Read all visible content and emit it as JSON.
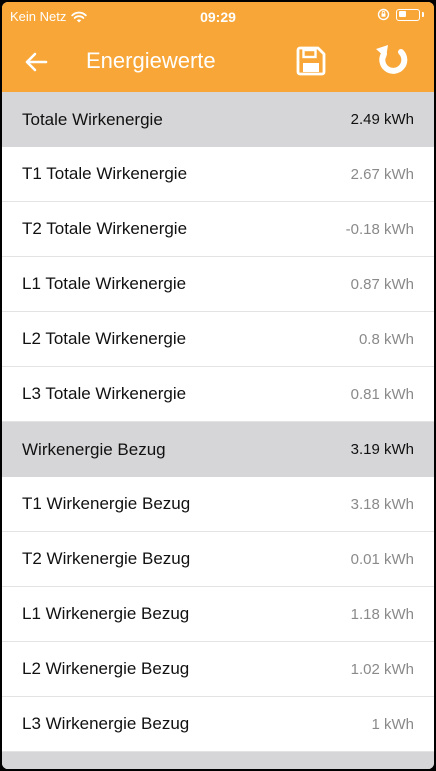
{
  "status_bar": {
    "carrier": "Kein Netz",
    "time": "09:29"
  },
  "nav": {
    "title": "Energiewerte",
    "back_icon": "arrow-left-icon",
    "save_icon": "floppy-disk-icon",
    "refresh_icon": "refresh-icon"
  },
  "colors": {
    "accent": "#f7a637",
    "section_bg": "#d6d6d8"
  },
  "rows": [
    {
      "label": "Totale Wirkenergie",
      "value": "2.49 kWh",
      "section": true
    },
    {
      "label": "T1 Totale Wirkenergie",
      "value": "2.67 kWh",
      "section": false
    },
    {
      "label": "T2 Totale Wirkenergie",
      "value": "-0.18 kWh",
      "section": false
    },
    {
      "label": "L1 Totale Wirkenergie",
      "value": "0.87 kWh",
      "section": false
    },
    {
      "label": "L2 Totale Wirkenergie",
      "value": "0.8 kWh",
      "section": false
    },
    {
      "label": "L3 Totale Wirkenergie",
      "value": "0.81 kWh",
      "section": false
    },
    {
      "label": "Wirkenergie Bezug",
      "value": "3.19 kWh",
      "section": true
    },
    {
      "label": "T1 Wirkenergie Bezug",
      "value": "3.18 kWh",
      "section": false
    },
    {
      "label": "T2 Wirkenergie Bezug",
      "value": "0.01 kWh",
      "section": false
    },
    {
      "label": "L1 Wirkenergie Bezug",
      "value": "1.18 kWh",
      "section": false
    },
    {
      "label": "L2 Wirkenergie Bezug",
      "value": "1.02 kWh",
      "section": false
    },
    {
      "label": "L3 Wirkenergie Bezug",
      "value": "1 kWh",
      "section": false
    }
  ]
}
